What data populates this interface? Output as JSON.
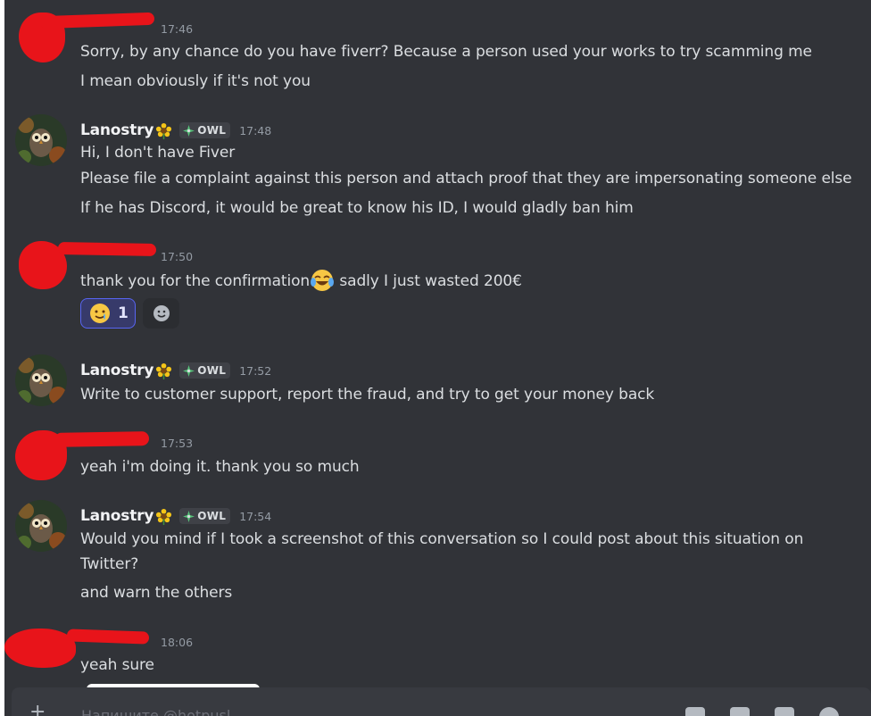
{
  "messages": [
    {
      "author": "",
      "time": "17:46",
      "lines": [
        "Sorry, by any chance do you have fiverr? Because a person used your works to try scamming me",
        "I mean obviously if it's not you"
      ]
    },
    {
      "author": "Lanostry",
      "tag": "OWL",
      "time": "17:48",
      "lines": [
        "Hi, I don't have Fiver",
        "Please file a complaint against this person and attach proof that they are impersonating someone else",
        "If he has Discord, it would be great to know his ID, I would gladly ban him"
      ]
    },
    {
      "author": "",
      "time": "17:50",
      "lines": [
        "thank you for the confirmation",
        " sadly I just wasted 200€"
      ],
      "reaction": {
        "emoji": "🥲",
        "count": "1"
      }
    },
    {
      "author": "Lanostry",
      "tag": "OWL",
      "time": "17:52",
      "lines": [
        "Write to customer support, report the fraud, and try to get your money back"
      ]
    },
    {
      "author": "",
      "time": "17:53",
      "lines": [
        "yeah i'm doing it. thank you so much"
      ]
    },
    {
      "author": "Lanostry",
      "tag": "OWL",
      "time": "17:54",
      "lines": [
        "Would you mind if I took a screenshot of this conversation so I could post about this situation on",
        "Twitter?",
        "and warn the others"
      ]
    },
    {
      "author": "",
      "time": "18:06",
      "lines": [
        "yeah sure"
      ]
    }
  ],
  "composer": {
    "placeholder": "Напишите @hotpusl",
    "plus_label": "+"
  },
  "icons": {
    "flower": "sunflower-emoji",
    "tag": "sparkle-icon",
    "laugh": "joy-emoji",
    "add_reaction": "add-reaction-icon"
  },
  "colors": {
    "background": "#313338",
    "redaction": "#e8141a",
    "text": "#dbdee1",
    "timestamp": "#949ba4",
    "reaction_border": "#5865f2"
  }
}
